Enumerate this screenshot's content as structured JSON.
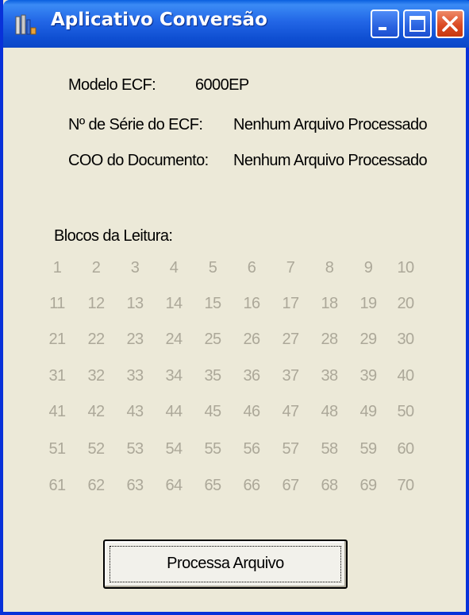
{
  "window": {
    "title": "Aplicativo Conversão"
  },
  "info": {
    "modelo_label": "Modelo ECF:",
    "modelo_value": "6000EP",
    "serie_label": "Nº de Série do ECF:",
    "serie_value": "Nenhum Arquivo Processado",
    "coo_label": "COO do Documento:",
    "coo_value": "Nenhum Arquivo Processado"
  },
  "blocos": {
    "label": "Blocos da Leitura:",
    "numbers": [
      "1",
      "2",
      "3",
      "4",
      "5",
      "6",
      "7",
      "8",
      "9",
      "10",
      "11",
      "12",
      "13",
      "14",
      "15",
      "16",
      "17",
      "18",
      "19",
      "20",
      "21",
      "22",
      "23",
      "24",
      "25",
      "26",
      "27",
      "28",
      "29",
      "30",
      "31",
      "32",
      "33",
      "34",
      "35",
      "36",
      "37",
      "38",
      "39",
      "40",
      "41",
      "42",
      "43",
      "44",
      "45",
      "46",
      "47",
      "48",
      "49",
      "50",
      "51",
      "52",
      "53",
      "54",
      "55",
      "56",
      "57",
      "58",
      "59",
      "60",
      "61",
      "62",
      "63",
      "64",
      "65",
      "66",
      "67",
      "68",
      "69",
      "70"
    ]
  },
  "button": {
    "label": "Processa Arquivo"
  },
  "icons": {
    "app": "app-icon",
    "minimize": "minimize-icon",
    "maximize": "maximize-icon",
    "close": "close-icon"
  },
  "colors": {
    "titlebar": "#2266E6",
    "disabled_text": "#ACA899",
    "face": "#ECE9D8"
  }
}
